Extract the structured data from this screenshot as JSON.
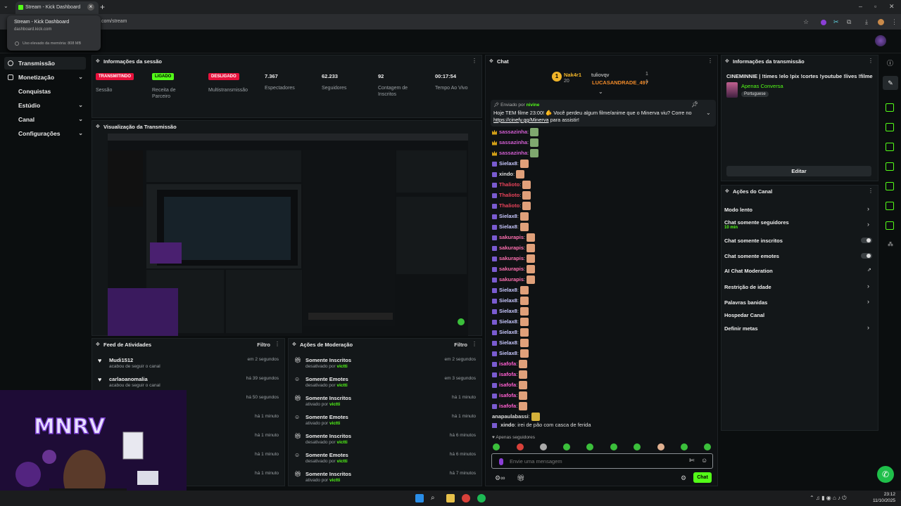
{
  "browser": {
    "tab_title": "Stream - Kick Dashboard",
    "url_partial": ".com/stream",
    "popup_title": "Stream - Kick Dashboard",
    "popup_domain": "dashboard.kick.com",
    "popup_memory": "Uso elevado da memória: 808 MB"
  },
  "sidebar": {
    "items": [
      {
        "label": "Transmissão",
        "active": true,
        "chevron": false
      },
      {
        "label": "Monetização",
        "chevron": true
      },
      {
        "label": "Conquistas",
        "chevron": false
      },
      {
        "label": "Estúdio",
        "chevron": true
      },
      {
        "label": "Canal",
        "chevron": true
      },
      {
        "label": "Configurações",
        "chevron": true
      }
    ]
  },
  "session": {
    "title": "Informações da sessão",
    "stats": [
      {
        "badge": "TRANSMITINDO",
        "badge_color": "#e9113c",
        "label": "Sessão"
      },
      {
        "badge": "LIGADO",
        "badge_color": "#53fc18",
        "label": "Receita de Parceiro"
      },
      {
        "badge": "DESLIGADO",
        "badge_color": "#e9113c",
        "label": "Multistransmissão"
      },
      {
        "value": "7.367",
        "label": "Espectadores"
      },
      {
        "value": "62.233",
        "label": "Seguidores"
      },
      {
        "value": "92",
        "label": "Contagem de Inscritos"
      },
      {
        "value": "00:17:54",
        "label": "Tempo Ao Vivo"
      }
    ]
  },
  "preview": {
    "title": "Visualização da Transmissão"
  },
  "activity": {
    "title": "Feed de Atividades",
    "filter": "Filtro",
    "rows": [
      {
        "name": "Mudi1512",
        "sub": "acabou de seguir o canal",
        "time": "em 2 segundos"
      },
      {
        "name": "carlaoanomalia",
        "sub": "acabou de seguir o canal",
        "time": "há 39 segundos"
      },
      {
        "name": "",
        "sub": "",
        "time": "há 50 segundos"
      },
      {
        "name": "",
        "sub": "",
        "time": "há 1 minuto"
      },
      {
        "name": "",
        "sub": "",
        "time": "há 1 minuto"
      },
      {
        "name": "",
        "sub": "",
        "time": "há 1 minuto"
      },
      {
        "name": "",
        "sub": "",
        "time": "há 1 minuto"
      }
    ]
  },
  "moderation": {
    "title": "Ações de Moderação",
    "filter": "Filtro",
    "rows": [
      {
        "name": "Somente Inscritos",
        "action": "desativado por",
        "user": "victti",
        "time": "em 2 segundos"
      },
      {
        "name": "Somente Emotes",
        "action": "desativado por",
        "user": "victti",
        "time": "em 3 segundos"
      },
      {
        "name": "Somente Inscritos",
        "action": "ativado por",
        "user": "victti",
        "time": "há 1 minuto"
      },
      {
        "name": "Somente Emotes",
        "action": "ativado por",
        "user": "victti",
        "time": "há 1 minuto"
      },
      {
        "name": "Somente Inscritos",
        "action": "desativado por",
        "user": "victti",
        "time": "há 6 minutos"
      },
      {
        "name": "Somente Emotes",
        "action": "desativado por",
        "user": "victti",
        "time": "há 6 minutos"
      },
      {
        "name": "Somente Inscritos",
        "action": "ativado por",
        "user": "victti",
        "time": "há 7 minutos"
      }
    ]
  },
  "chat": {
    "title": "Chat",
    "top_gifters": [
      {
        "name": "Nak4r1",
        "count": "20"
      },
      {
        "name": "tuliovqv",
        "count": "1"
      },
      {
        "name": "LUCASANDRADE_497",
        "count": "1"
      }
    ],
    "pinned": {
      "by_label": "Enviado por",
      "by_user": "nivine",
      "text": "Hoje TEM filme 23:00! 🫵 Você perdeu algum filme/anime que o Minerva viu? Corre no",
      "link": "https://cinefy.gg/Minerva",
      "tail": "para assistir!"
    },
    "messages": [
      {
        "user": "sassazinha",
        "color": "#d35fd3",
        "badge": "crown"
      },
      {
        "user": "sassazinha",
        "color": "#d35fd3",
        "badge": "crown"
      },
      {
        "user": "sassazinha",
        "color": "#d35fd3",
        "badge": "crown"
      },
      {
        "user": "Sielax8",
        "color": "#c8c8ff",
        "badge": "sub"
      },
      {
        "user": "xindo",
        "color": "#dddddd",
        "badge": "sub"
      },
      {
        "user": "Thalioto",
        "color": "#e9435a",
        "badge": "sub"
      },
      {
        "user": "Thalioto",
        "color": "#e9435a",
        "badge": "sub"
      },
      {
        "user": "Thalioto",
        "color": "#e9435a",
        "badge": "sub"
      },
      {
        "user": "Sielax8",
        "color": "#c8c8ff",
        "badge": "sub"
      },
      {
        "user": "Sielax8",
        "color": "#c8c8ff",
        "badge": "sub"
      },
      {
        "user": "sakurapis",
        "color": "#ff6fb0",
        "badge": "sub"
      },
      {
        "user": "sakurapis",
        "color": "#ff6fb0",
        "badge": "sub"
      },
      {
        "user": "sakurapis",
        "color": "#ff6fb0",
        "badge": "sub"
      },
      {
        "user": "sakurapis",
        "color": "#ff6fb0",
        "badge": "sub"
      },
      {
        "user": "sakurapis",
        "color": "#ff6fb0",
        "badge": "sub"
      },
      {
        "user": "Sielax8",
        "color": "#c8c8ff",
        "badge": "sub"
      },
      {
        "user": "Sielax8",
        "color": "#c8c8ff",
        "badge": "sub"
      },
      {
        "user": "Sielax8",
        "color": "#c8c8ff",
        "badge": "sub"
      },
      {
        "user": "Sielax8",
        "color": "#c8c8ff",
        "badge": "sub"
      },
      {
        "user": "Sielax8",
        "color": "#c8c8ff",
        "badge": "sub"
      },
      {
        "user": "Sielax8",
        "color": "#c8c8ff",
        "badge": "sub"
      },
      {
        "user": "Sielax8",
        "color": "#c8c8ff",
        "badge": "sub"
      },
      {
        "user": "isafofa",
        "color": "#ff5fd0",
        "badge": "sub"
      },
      {
        "user": "isafofa",
        "color": "#ff5fd0",
        "badge": "sub"
      },
      {
        "user": "isafofa",
        "color": "#ff5fd0",
        "badge": "sub"
      },
      {
        "user": "isafofa",
        "color": "#ff5fd0",
        "badge": "sub"
      },
      {
        "user": "isafofa",
        "color": "#ff5fd0",
        "badge": "sub"
      },
      {
        "user": "anapaulabassi",
        "color": "#dddddd",
        "badge": "none"
      }
    ],
    "last_message": {
      "user": "xindo",
      "text": "irei de pão com casca de ferida"
    },
    "followers_only": "Apenas seguidores",
    "input_placeholder": "Envie uma mensagem",
    "send_label": "Chat"
  },
  "stream_info": {
    "title": "Informações da transmissão",
    "stream_title": "CINEMINNIE | !times !elo !pix !cortes !youtube !lives !filme",
    "category": "Apenas Conversa",
    "language": "Portuguese",
    "edit_label": "Editar"
  },
  "channel_actions": {
    "title": "Ações do Canal",
    "rows": [
      {
        "label": "Modo lento",
        "control": "chevron"
      },
      {
        "label": "Chat somente seguidores",
        "sub": "10 min",
        "control": "chevron"
      },
      {
        "label": "Chat somente inscritos",
        "control": "toggle"
      },
      {
        "label": "Chat somente emotes",
        "control": "toggle"
      },
      {
        "label": "AI Chat Moderation",
        "control": "external"
      },
      {
        "label": "Restrição de idade",
        "control": "chevron"
      },
      {
        "label": "Palavras banidas",
        "control": "chevron"
      },
      {
        "label": "Hospedar Canal",
        "control": "none"
      },
      {
        "label": "Definir metas",
        "control": "chevron"
      }
    ]
  },
  "taskbar": {
    "time": "23:12",
    "date": "11/10/2025"
  },
  "colors": {
    "kick_green": "#53fc18",
    "live_red": "#e9113c",
    "panel_bg": "#131719"
  }
}
